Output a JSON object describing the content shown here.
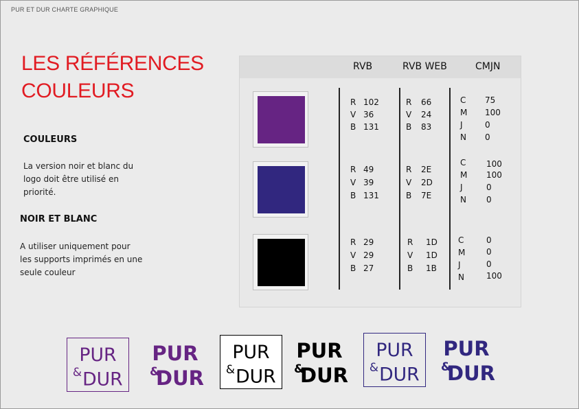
{
  "header": {
    "label": "PUR ET DUR CHARTE GRAPHIQUE"
  },
  "title": {
    "line1": "LES RÉFÉRENCES",
    "line2": "COULEURS"
  },
  "section_couleurs": {
    "heading": "COULEURS",
    "text": "La version noir et blanc du logo doit être utilisé en priorité."
  },
  "section_noir_blanc": {
    "heading": "NOIR ET BLANC",
    "text": "A utiliser uniquement pour les supports imprimés en une seule couleur"
  },
  "table": {
    "col_rvb": "RVB",
    "col_rvb_web": "RVB WEB",
    "col_cmjn": "CMJN",
    "rows": [
      {
        "swatch_color": "#662483",
        "rvb": {
          "r_label": "R",
          "r": "102",
          "v_label": "V",
          "v": "36",
          "b_label": "B",
          "b": "131"
        },
        "web": {
          "r_label": "R",
          "r": "66",
          "v_label": "V",
          "v": "24",
          "b_label": "B",
          "b": "83"
        },
        "cmjn": {
          "c_label": "C",
          "c": "75",
          "m_label": "M",
          "m": "100",
          "j_label": "J",
          "j": "0",
          "n_label": "N",
          "n": "0"
        }
      },
      {
        "swatch_color": "#31277f",
        "rvb": {
          "r_label": "R",
          "r": "49",
          "v_label": "V",
          "v": "39",
          "b_label": "B",
          "b": "131"
        },
        "web": {
          "r_label": "R",
          "r": "2E",
          "v_label": "V",
          "v": "2D",
          "b_label": "B",
          "b": "7E"
        },
        "cmjn": {
          "c_label": "C",
          "c": "100",
          "m_label": "M",
          "m": "100",
          "j_label": "J",
          "j": "0",
          "n_label": "N",
          "n": "0"
        }
      },
      {
        "swatch_color": "#000000",
        "rvb": {
          "r_label": "R",
          "r": "29",
          "v_label": "V",
          "v": "29",
          "b_label": "B",
          "b": "27"
        },
        "web": {
          "r_label": "R",
          "r": "1D",
          "v_label": "V",
          "v": "1D",
          "b_label": "B",
          "b": "1B"
        },
        "cmjn": {
          "c_label": "C",
          "c": "0",
          "m_label": "M",
          "m": "0",
          "j_label": "J",
          "j": "0",
          "n_label": "N",
          "n": "100"
        }
      }
    ]
  },
  "logos": {
    "word_top": "PUR",
    "word_bottom": "DUR",
    "ampersand": "&",
    "colors": {
      "purple": "#662483",
      "black": "#000000",
      "indigo": "#31277f"
    }
  }
}
